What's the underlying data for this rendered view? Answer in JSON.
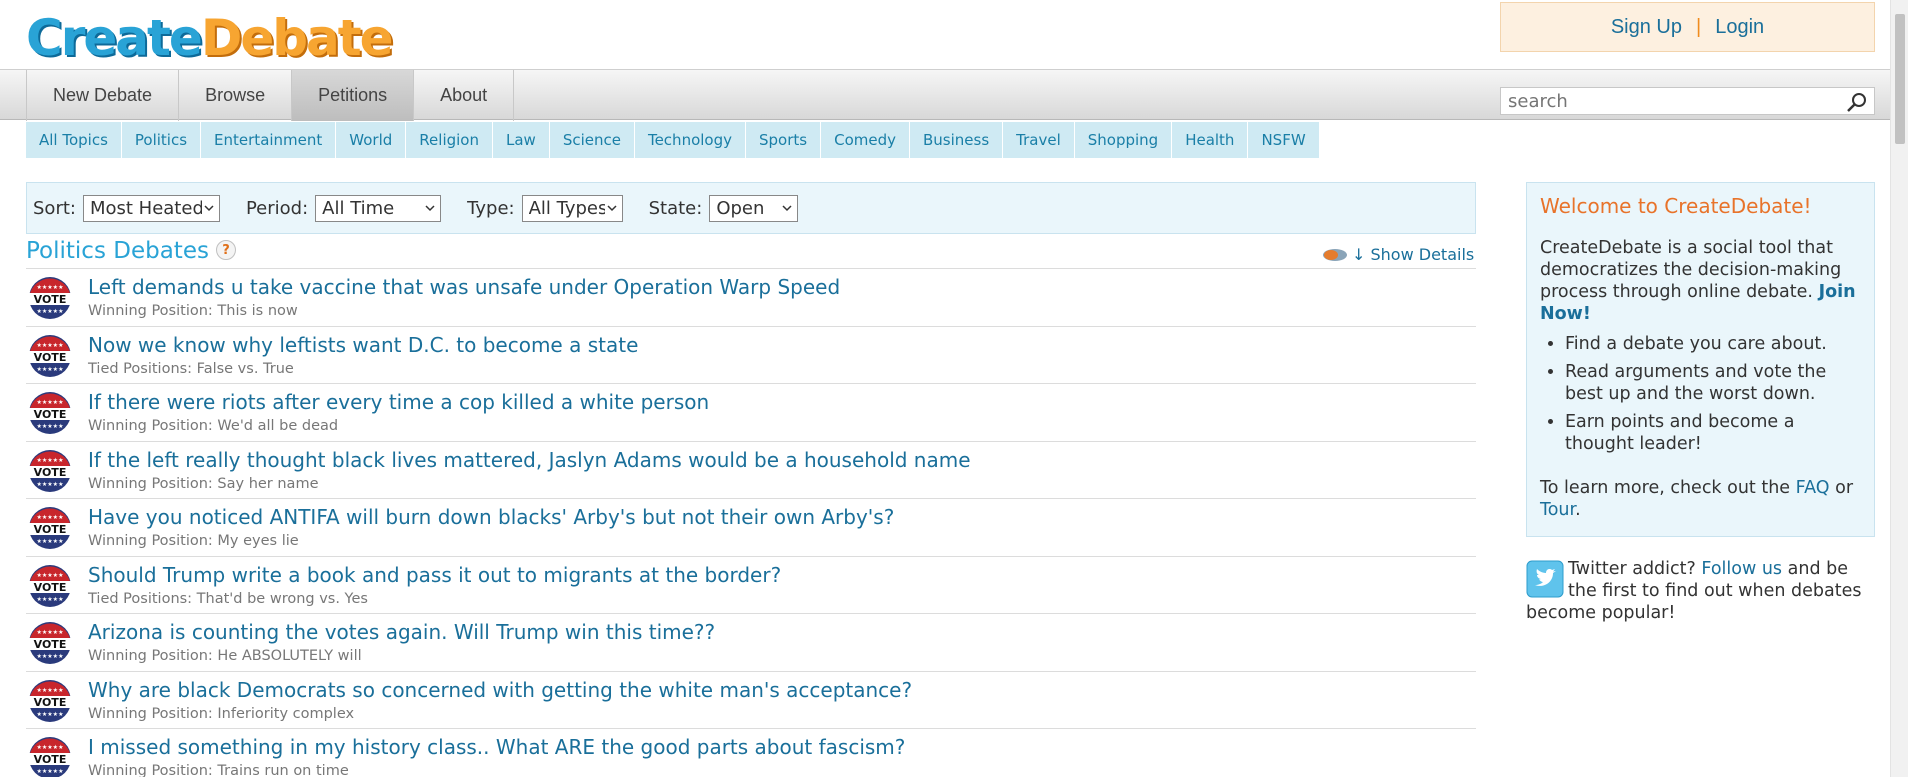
{
  "logo": {
    "part1": "Create",
    "part2": "Debate"
  },
  "auth": {
    "signup": "Sign Up",
    "separator": "|",
    "login": "Login"
  },
  "nav": {
    "tabs": [
      {
        "label": "New Debate"
      },
      {
        "label": "Browse"
      },
      {
        "label": "Petitions",
        "active": true
      },
      {
        "label": "About"
      }
    ]
  },
  "search": {
    "placeholder": "search"
  },
  "topics": [
    "All Topics",
    "Politics",
    "Entertainment",
    "World",
    "Religion",
    "Law",
    "Science",
    "Technology",
    "Sports",
    "Comedy",
    "Business",
    "Travel",
    "Shopping",
    "Health",
    "NSFW"
  ],
  "filters": {
    "sort": {
      "label": "Sort:",
      "value": "Most Heated"
    },
    "period": {
      "label": "Period:",
      "value": "All Time"
    },
    "type": {
      "label": "Type:",
      "value": "All Types"
    },
    "state": {
      "label": "State:",
      "value": "Open"
    }
  },
  "section": {
    "title": "Politics Debates",
    "help": "?",
    "show_details": "↓ Show Details"
  },
  "debates": [
    {
      "title": "Left demands u take vaccine that was unsafe under Operation Warp Speed",
      "position": "Winning Position: This is now"
    },
    {
      "title": "Now we know why leftists want D.C. to become a state",
      "position": "Tied Positions: False vs. True"
    },
    {
      "title": "If there were riots after every time a cop killed a white person",
      "position": "Winning Position: We'd all be dead"
    },
    {
      "title": "If the left really thought black lives mattered, Jaslyn Adams would be a household name",
      "position": "Winning Position: Say her name"
    },
    {
      "title": "Have you noticed ANTIFA will burn down blacks' Arby's but not their own Arby's?",
      "position": "Winning Position: My eyes lie"
    },
    {
      "title": "Should Trump write a book and pass it out to migrants at the border?",
      "position": "Tied Positions: That'd be wrong vs. Yes"
    },
    {
      "title": "Arizona is counting the votes again. Will Trump win this time??",
      "position": "Winning Position: He ABSOLUTELY will"
    },
    {
      "title": "Why are black Democrats so concerned with getting the white man's acceptance?",
      "position": "Winning Position: Inferiority complex"
    },
    {
      "title": "I missed something in my history class.. What ARE the good parts about fascism?",
      "position": "Winning Position: Trains run on time"
    }
  ],
  "vote_icon_text": "VOTE",
  "welcome": {
    "heading": "Welcome to CreateDebate!",
    "intro": "CreateDebate is a social tool that democratizes the decision-making process through online debate.",
    "join": "Join Now!",
    "bullets": [
      "Find a debate you care about.",
      "Read arguments and vote the best up and the worst down.",
      "Earn points and become a thought leader!"
    ],
    "learn_prefix": "To learn more, check out the",
    "faq": "FAQ",
    "or": "or",
    "tour": "Tour",
    "period": "."
  },
  "twitter": {
    "prefix": "Twitter addict?",
    "link": "Follow us",
    "suffix": "and be the first to find out when debates become popular!"
  },
  "colors": {
    "brand_blue": "#29a3d6",
    "brand_orange": "#f7a531",
    "link": "#1a6f9a",
    "topic_bg": "#cfeaf3",
    "panel_bg": "#eaf6fb"
  }
}
